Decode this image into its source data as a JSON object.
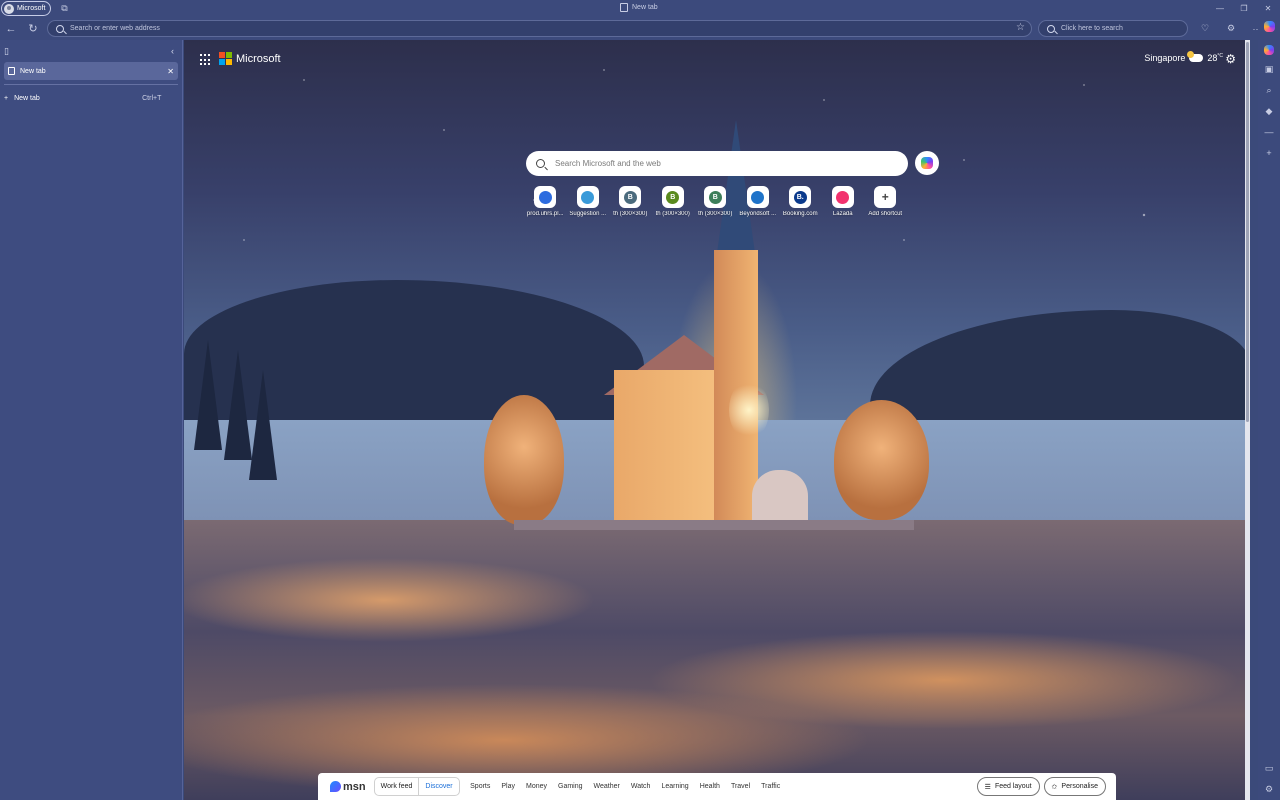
{
  "window": {
    "profile_label": "Microsoft",
    "tab_title": "New tab"
  },
  "toolbar": {
    "address_placeholder": "Search or enter web address",
    "bing_placeholder": "Click here to search"
  },
  "sidebar": {
    "tabs": [
      {
        "label": "New tab"
      }
    ],
    "new_tab_label": "New tab",
    "new_tab_shortcut": "Ctrl+T"
  },
  "ntp": {
    "brand": "Microsoft",
    "weather": {
      "city": "Singapore",
      "temp": "28",
      "unit": "°C"
    },
    "search_placeholder": "Search Microsoft and the web",
    "shortcuts": [
      {
        "label": "prod.uhrs.pl...",
        "glyph": "",
        "color": "#2d6cdf"
      },
      {
        "label": "Suggestion ...",
        "glyph": "",
        "color": "#3a9ad9"
      },
      {
        "label": "th (300×300)",
        "glyph": "B",
        "color": "#4b6b7d"
      },
      {
        "label": "th (300×300)",
        "glyph": "B",
        "color": "#5a8a1e"
      },
      {
        "label": "th (300×300)",
        "glyph": "B",
        "color": "#3d7f5a"
      },
      {
        "label": "Beyondsoft ...",
        "glyph": "",
        "color": "#1f73c9"
      },
      {
        "label": "Booking.com",
        "glyph": "B.",
        "color": "#0b3a8c"
      },
      {
        "label": "Lazada",
        "glyph": "",
        "color": "#f2326e"
      },
      {
        "label": "Add shortcut",
        "glyph": "+",
        "color": "#ffffff"
      }
    ]
  },
  "msn": {
    "logo": "msn",
    "work_feed": "Work feed",
    "discover": "Discover",
    "categories": [
      "Sports",
      "Play",
      "Money",
      "Gaming",
      "Weather",
      "Watch",
      "Learning",
      "Health",
      "Travel",
      "Traffic"
    ],
    "feed_layout": "Feed layout",
    "personalise": "Personalise"
  }
}
